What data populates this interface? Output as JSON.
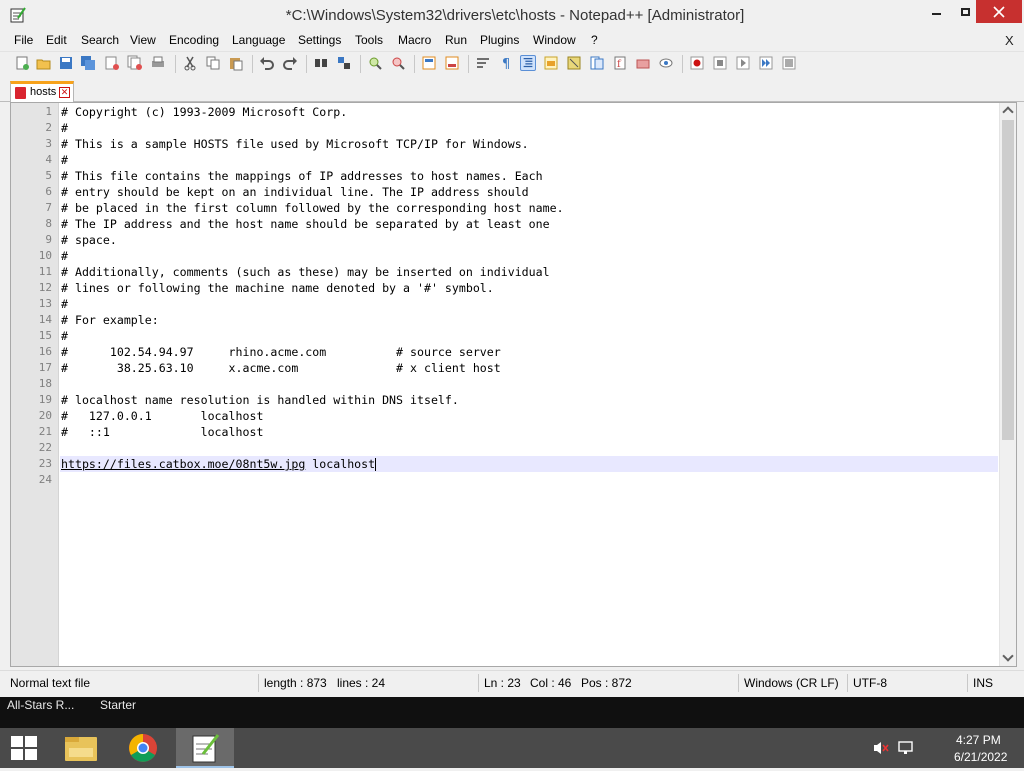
{
  "window": {
    "title": "*C:\\Windows\\System32\\drivers\\etc\\hosts - Notepad++ [Administrator]"
  },
  "menu": [
    "File",
    "Edit",
    "Search",
    "View",
    "Encoding",
    "Language",
    "Settings",
    "Tools",
    "Macro",
    "Run",
    "Plugins",
    "Window",
    "?"
  ],
  "menu_close": "X",
  "toolbar": {
    "icons": [
      "new-file-icon",
      "open-file-icon",
      "save-icon",
      "save-all-icon",
      "close-icon",
      "close-all-icon",
      "print-icon",
      "cut-icon",
      "copy-icon",
      "paste-icon",
      "undo-icon",
      "redo-icon",
      "find-icon",
      "replace-icon",
      "zoom-in-icon",
      "zoom-out-icon",
      "sync-vertical-icon",
      "sync-horizontal-icon",
      "word-wrap-icon",
      "show-all-chars-icon",
      "indent-guide-icon",
      "user-language-icon",
      "doc-map-icon",
      "function-list-icon",
      "folder-as-workspace-icon",
      "monitoring-icon",
      "record-macro-icon",
      "stop-record-icon",
      "play-macro-icon",
      "run-macro-multiple-icon",
      "save-macro-icon"
    ]
  },
  "tab": {
    "label": "hosts",
    "close": "✕"
  },
  "editor": {
    "lines": [
      "# Copyright (c) 1993-2009 Microsoft Corp.",
      "#",
      "# This is a sample HOSTS file used by Microsoft TCP/IP for Windows.",
      "#",
      "# This file contains the mappings of IP addresses to host names. Each",
      "# entry should be kept on an individual line. The IP address should",
      "# be placed in the first column followed by the corresponding host name.",
      "# The IP address and the host name should be separated by at least one",
      "# space.",
      "#",
      "# Additionally, comments (such as these) may be inserted on individual",
      "# lines or following the machine name denoted by a '#' symbol.",
      "#",
      "# For example:",
      "#",
      "#      102.54.94.97     rhino.acme.com          # source server",
      "#       38.25.63.10     x.acme.com              # x client host",
      "",
      "# localhost name resolution is handled within DNS itself.",
      "#   127.0.0.1       localhost",
      "#   ::1             localhost",
      "",
      "https://files.catbox.moe/08nt5w.jpg localhost",
      ""
    ],
    "line23_url": "https://files.catbox.moe/08nt5w.jpg",
    "line23_rest": " localhost",
    "current_line": 23
  },
  "status": {
    "file_type": "Normal text file",
    "length": "length : 873",
    "lines": "lines : 24",
    "ln": "Ln : 23",
    "col": "Col : 46",
    "pos": "Pos : 872",
    "eol": "Windows (CR LF)",
    "encoding": "UTF-8",
    "mode": "INS"
  },
  "strip": {
    "left": "All-Stars R...",
    "right": "Starter"
  },
  "taskbar": {
    "apps": [
      "file-explorer-icon",
      "chrome-icon",
      "notepad-plus-plus-icon"
    ],
    "time": "4:27 PM",
    "date": "6/21/2022"
  },
  "colors": {
    "accent_tab": "#f7a21b",
    "current_line_bg": "#e8e8ff",
    "close_button": "#c7302f",
    "taskbar": "#4a4a4a"
  }
}
